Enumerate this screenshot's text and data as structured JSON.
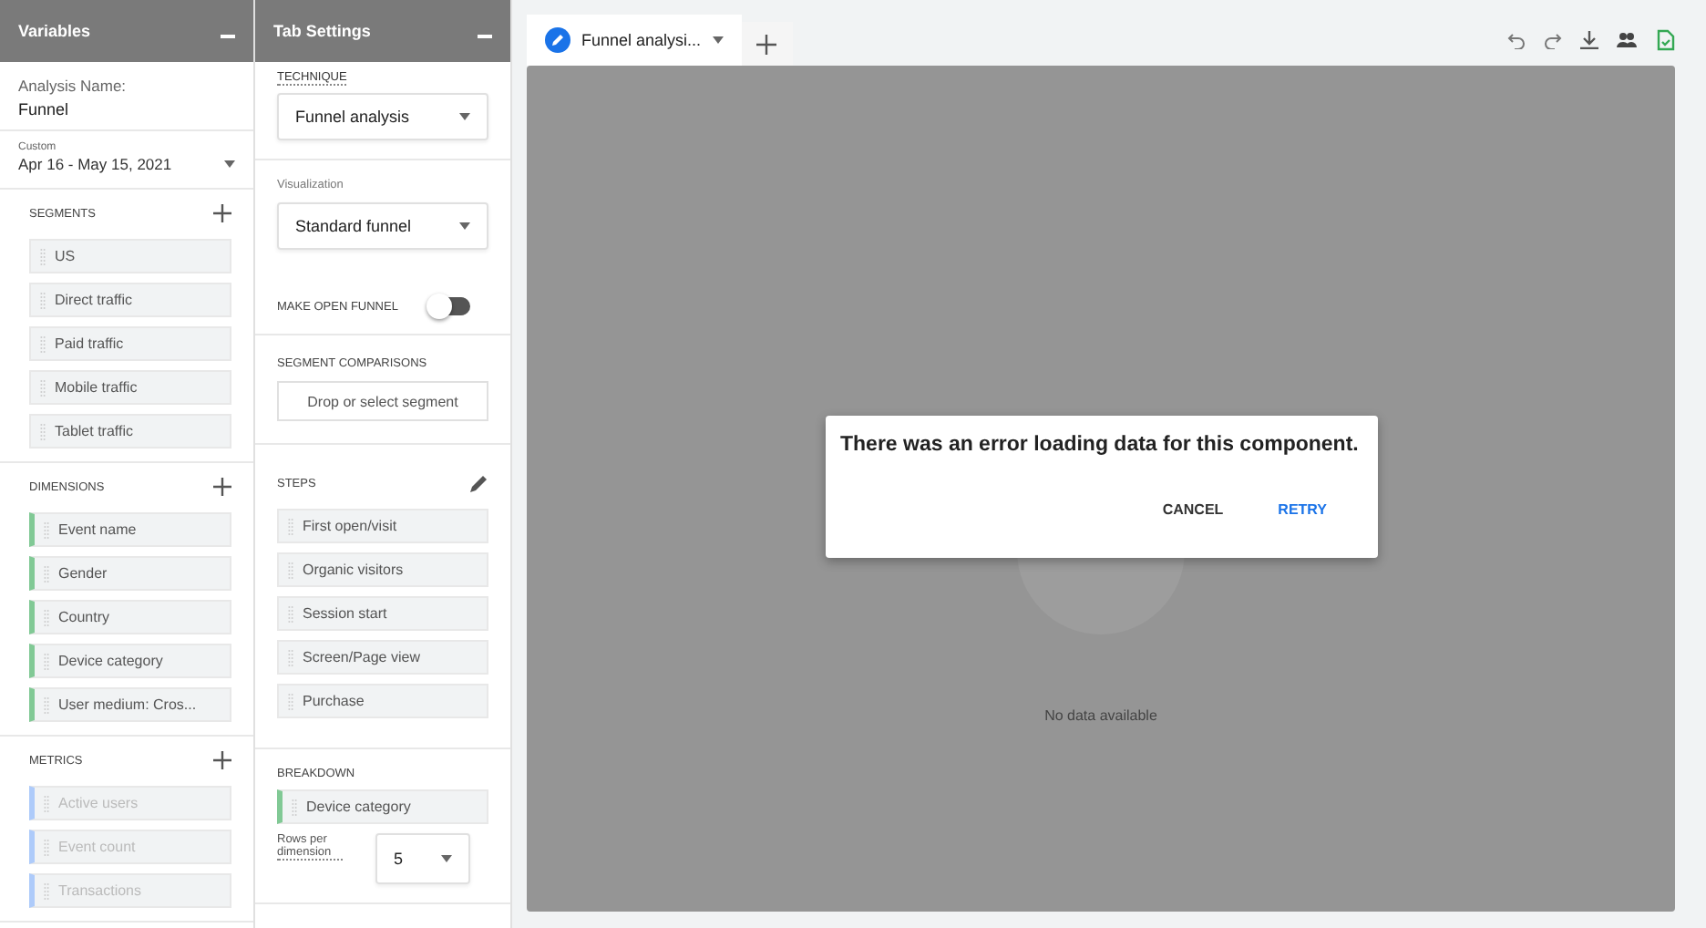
{
  "variables_panel": {
    "title": "Variables",
    "analysis_name_label": "Analysis Name:",
    "analysis_name": "Funnel",
    "date_range": {
      "badge": "Custom",
      "value": "Apr 16 - May 15, 2021"
    },
    "sections": [
      {
        "title": "SEGMENTS",
        "kind": "segment",
        "items": [
          {
            "label": "US",
            "disabled": false
          },
          {
            "label": "Direct traffic",
            "disabled": false
          },
          {
            "label": "Paid traffic",
            "disabled": false
          },
          {
            "label": "Mobile traffic",
            "disabled": false
          },
          {
            "label": "Tablet traffic",
            "disabled": false
          }
        ]
      },
      {
        "title": "DIMENSIONS",
        "kind": "dimension",
        "items": [
          {
            "label": "Event name",
            "disabled": false
          },
          {
            "label": "Gender",
            "disabled": false
          },
          {
            "label": "Country",
            "disabled": false
          },
          {
            "label": "Device category",
            "disabled": false
          },
          {
            "label": "User medium: Cros...",
            "disabled": false
          }
        ]
      },
      {
        "title": "METRICS",
        "kind": "metric",
        "items": [
          {
            "label": "Active users",
            "disabled": true
          },
          {
            "label": "Event count",
            "disabled": true
          },
          {
            "label": "Transactions",
            "disabled": true
          }
        ]
      }
    ]
  },
  "tab_settings": {
    "title": "Tab Settings",
    "technique": {
      "label": "TECHNIQUE",
      "value": "Funnel analysis"
    },
    "visualization": {
      "label": "Visualization",
      "value": "Standard funnel"
    },
    "open_funnel": {
      "label": "MAKE OPEN FUNNEL",
      "on": false
    },
    "segment_comparisons": {
      "label": "SEGMENT COMPARISONS",
      "placeholder": "Drop or select segment"
    },
    "steps": {
      "title": "STEPS",
      "items": [
        {
          "label": "First open/visit"
        },
        {
          "label": "Organic visitors"
        },
        {
          "label": "Session start"
        },
        {
          "label": "Screen/Page view"
        },
        {
          "label": "Purchase"
        }
      ]
    },
    "breakdown": {
      "title": "BREAKDOWN",
      "kind": "dimension",
      "items": [
        {
          "label": "Device category"
        }
      ]
    },
    "rows_per_dimension": {
      "label": "Rows per dimension",
      "value": "5"
    }
  },
  "canvas": {
    "tabs": [
      {
        "label": "Funnel analysi...",
        "selected": true
      }
    ],
    "dialog": {
      "message": "There was an error loading data for this component.",
      "buttons": [
        {
          "label": "CANCEL",
          "kind": "secondary"
        },
        {
          "label": "RETRY",
          "kind": "primary"
        }
      ]
    },
    "empty_text": "No data available"
  }
}
